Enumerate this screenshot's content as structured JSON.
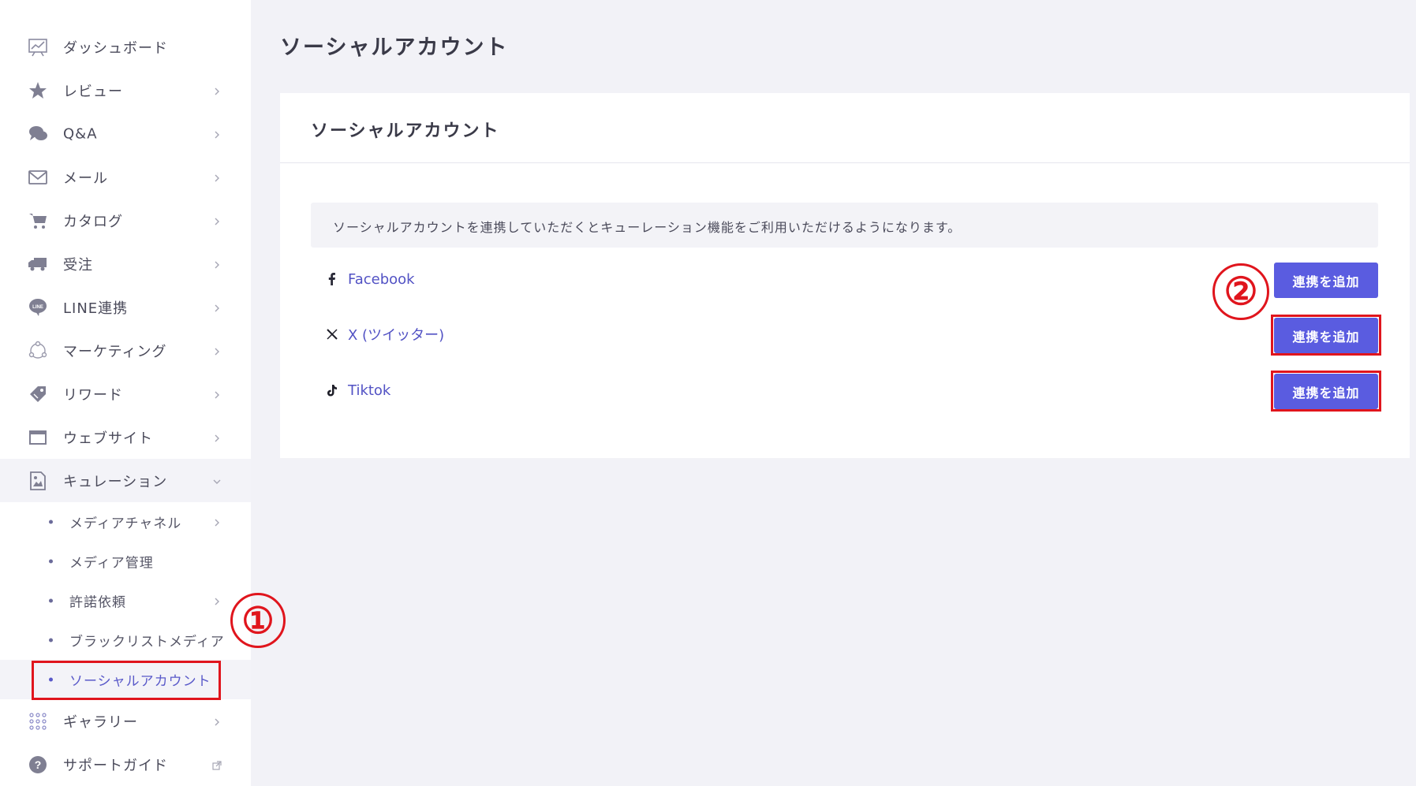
{
  "sidebar": {
    "items": [
      {
        "label": "ダッシュボード",
        "icon": "dashboard-chart-icon"
      },
      {
        "label": "レビュー",
        "icon": "star-icon"
      },
      {
        "label": "Q&A",
        "icon": "chat-bubbles-icon"
      },
      {
        "label": "メール",
        "icon": "envelope-icon"
      },
      {
        "label": "カタログ",
        "icon": "cart-icon"
      },
      {
        "label": "受注",
        "icon": "truck-icon"
      },
      {
        "label": "LINE連携",
        "icon": "line-icon"
      },
      {
        "label": "マーケティング",
        "icon": "network-icon"
      },
      {
        "label": "リワード",
        "icon": "tag-icon"
      },
      {
        "label": "ウェブサイト",
        "icon": "browser-window-icon"
      },
      {
        "label": "キュレーション",
        "icon": "image-document-icon"
      }
    ],
    "curation_sub": [
      {
        "label": "メディアチャネル"
      },
      {
        "label": "メディア管理"
      },
      {
        "label": "許諾依頼"
      },
      {
        "label": "ブラックリストメディア"
      },
      {
        "label": "ソーシャルアカウント"
      }
    ],
    "bottom_items": [
      {
        "label": "ギャラリー",
        "icon": "grid-dots-icon"
      },
      {
        "label": "サポートガイド",
        "icon": "question-circle-icon"
      }
    ]
  },
  "page": {
    "title": "ソーシャルアカウント"
  },
  "card": {
    "title": "ソーシャルアカウント",
    "info": "ソーシャルアカウントを連携していただくとキューレーション機能をご利用いただけるようになります。",
    "accounts": [
      {
        "name": "Facebook",
        "icon": "facebook-icon",
        "button": "連携を追加"
      },
      {
        "name": "X (ツイッター)",
        "icon": "x-icon",
        "button": "連携を追加"
      },
      {
        "name": "Tiktok",
        "icon": "tiktok-icon",
        "button": "連携を追加"
      }
    ]
  },
  "annotations": {
    "step1": "①",
    "step2": "②",
    "color": "#e0151d"
  },
  "colors": {
    "accent": "#5a5ce0",
    "link": "#5252c4",
    "background": "#f2f2f7"
  }
}
